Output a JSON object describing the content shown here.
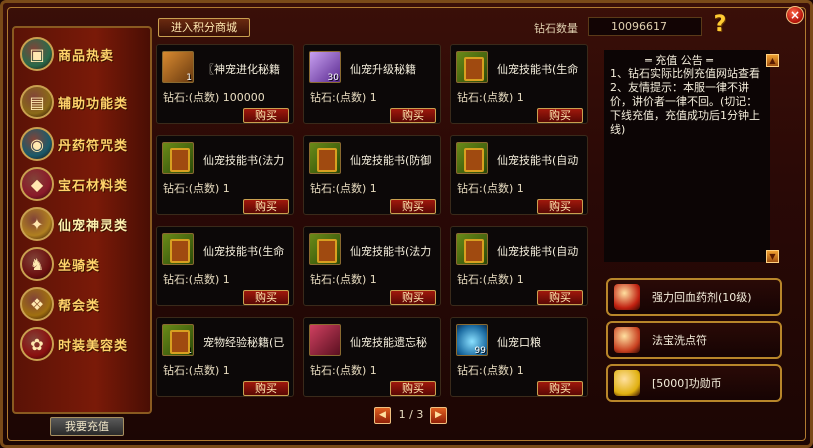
{
  "window": {
    "close_label": "×"
  },
  "sidebar": {
    "items": [
      {
        "label": "商品热卖",
        "icon": "chest-icon",
        "color": "#2a6a4a",
        "glyph": "▣"
      },
      {
        "label": "辅助功能类",
        "icon": "book-icon",
        "color": "#8a6a18",
        "glyph": "▤"
      },
      {
        "label": "丹药符咒类",
        "icon": "orb-icon",
        "color": "#1a5a6a",
        "glyph": "◉"
      },
      {
        "label": "宝石材料类",
        "icon": "gem-icon",
        "color": "#8a1a2a",
        "glyph": "◆"
      },
      {
        "label": "仙宠神灵类",
        "icon": "pet-icon",
        "color": "#b08020",
        "glyph": "✦"
      },
      {
        "label": "坐骑类",
        "icon": "mount-icon",
        "color": "#6a1010",
        "glyph": "♞"
      },
      {
        "label": "帮会类",
        "icon": "guild-icon",
        "color": "#a07010",
        "glyph": "❖"
      },
      {
        "label": "时装美容类",
        "icon": "fashion-icon",
        "color": "#8a1010",
        "glyph": "✿"
      }
    ],
    "active_index": 4,
    "recharge_label": "我要充值"
  },
  "topbar": {
    "mall_label": "进入积分商城",
    "gem_label": "钻石数量",
    "gem_value": "10096617"
  },
  "products": [
    {
      "name": "〖神宠进化秘籍",
      "price": "钻石:(点数) 100000",
      "icon": "pet",
      "qty": "1",
      "buy": "购买"
    },
    {
      "name": "仙宠升级秘籍",
      "price": "钻石:(点数) 1",
      "icon": "purple",
      "qty": "30",
      "buy": "购买"
    },
    {
      "name": "仙宠技能书(生命",
      "price": "钻石:(点数) 1",
      "icon": "book",
      "qty": "",
      "buy": "购买"
    },
    {
      "name": "仙宠技能书(法力",
      "price": "钻石:(点数) 1",
      "icon": "book",
      "qty": "",
      "buy": "购买"
    },
    {
      "name": "仙宠技能书(防御",
      "price": "钻石:(点数) 1",
      "icon": "book",
      "qty": "",
      "buy": "购买"
    },
    {
      "name": "仙宠技能书(自动",
      "price": "钻石:(点数) 1",
      "icon": "book",
      "qty": "",
      "buy": "购买"
    },
    {
      "name": "仙宠技能书(生命",
      "price": "钻石:(点数) 1",
      "icon": "book",
      "qty": "",
      "buy": "购买"
    },
    {
      "name": "仙宠技能书(法力",
      "price": "钻石:(点数) 1",
      "icon": "book",
      "qty": "",
      "buy": "购买"
    },
    {
      "name": "仙宠技能书(自动",
      "price": "钻石:(点数) 1",
      "icon": "book",
      "qty": "",
      "buy": "购买"
    },
    {
      "name": "宠物经验秘籍(已",
      "price": "钻石:(点数) 1",
      "icon": "book",
      "qty": "1",
      "buy": "购买"
    },
    {
      "name": "仙宠技能遗忘秘",
      "price": "钻石:(点数) 1",
      "icon": "red",
      "qty": "",
      "buy": "购买"
    },
    {
      "name": "仙宠口粮",
      "price": "钻石:(点数) 1",
      "icon": "blue",
      "qty": "99",
      "buy": "购买"
    }
  ],
  "pager": {
    "text": "1 / 3",
    "prev": "◀",
    "next": "▶"
  },
  "notice": {
    "title": "═ 充值 公告 ═",
    "body": "1、钻石实际比例充值网站查看\n2、友情提示：本服一律不讲价，讲价者一律不回。(切记：下线充值，充值成功后1分钟上线)"
  },
  "promos": [
    {
      "label": "强力回血药剂(10级)",
      "color": "#c02010"
    },
    {
      "label": "法宝洗点符",
      "color": "#c84020"
    },
    {
      "label": "[5000]功勋币",
      "color": "#e0b010"
    }
  ]
}
